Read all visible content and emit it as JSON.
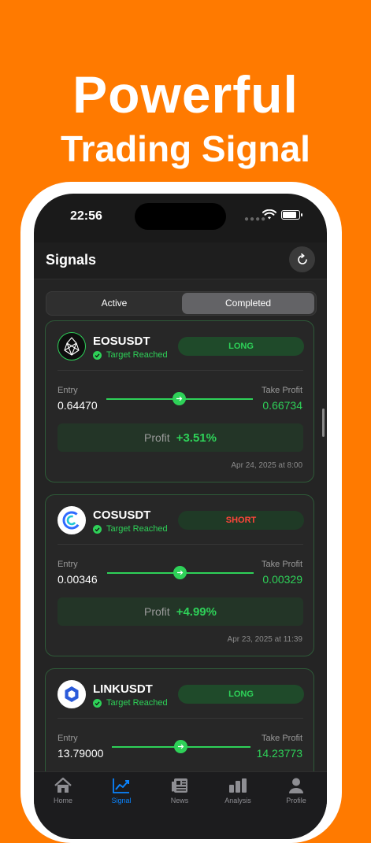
{
  "headline": {
    "line1": "Powerful",
    "line2": "Trading Signal"
  },
  "status_bar": {
    "time": "22:56"
  },
  "nav": {
    "title": "Signals"
  },
  "segments": {
    "active": "Active",
    "completed": "Completed",
    "selected": "Completed"
  },
  "signals": [
    {
      "symbol": "EOSUSDT",
      "status": "Target Reached",
      "direction": "LONG",
      "entry_label": "Entry",
      "entry": "0.64470",
      "tp_label": "Take Profit",
      "take_profit": "0.66734",
      "profit_label": "Profit",
      "profit": "+3.51%",
      "date": "Apr 24, 2025 at 8:00",
      "icon": "eos-logo-icon"
    },
    {
      "symbol": "COSUSDT",
      "status": "Target Reached",
      "direction": "SHORT",
      "entry_label": "Entry",
      "entry": "0.00346",
      "tp_label": "Take Profit",
      "take_profit": "0.00329",
      "profit_label": "Profit",
      "profit": "+4.99%",
      "date": "Apr 23, 2025 at 11:39",
      "icon": "contentos-logo-icon"
    },
    {
      "symbol": "LINKUSDT",
      "status": "Target Reached",
      "direction": "LONG",
      "entry_label": "Entry",
      "entry": "13.79000",
      "tp_label": "Take Profit",
      "take_profit": "14.23773",
      "icon": "chainlink-logo-icon"
    }
  ],
  "tabs": [
    {
      "label": "Home",
      "icon": "home-icon"
    },
    {
      "label": "Signal",
      "icon": "chart-line-icon",
      "active": true
    },
    {
      "label": "News",
      "icon": "newspaper-icon"
    },
    {
      "label": "Analysis",
      "icon": "bar-chart-icon"
    },
    {
      "label": "Profile",
      "icon": "person-icon"
    }
  ],
  "colors": {
    "background": "#FF7A00",
    "accent_green": "#2ED158",
    "short_red": "#FF453A",
    "tab_active": "#0A84FF"
  }
}
